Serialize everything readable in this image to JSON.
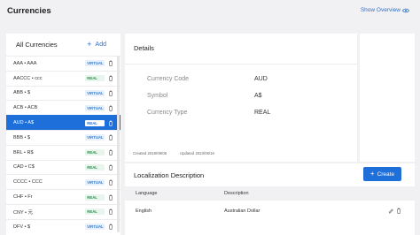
{
  "page": {
    "title": "Currencies",
    "show_overview_label": "Show Overview"
  },
  "list_panel": {
    "title": "All Currencies",
    "add_label": "Add",
    "items": [
      {
        "name": "AAA • AAA",
        "type": "VIRTUAL"
      },
      {
        "name": "AACCC • ccc",
        "type": "REAL"
      },
      {
        "name": "ABB • $",
        "type": "VIRTUAL"
      },
      {
        "name": "ACB • ACB",
        "type": "VIRTUAL"
      },
      {
        "name": "AUD • A$",
        "type": "REAL",
        "selected": true
      },
      {
        "name": "BBB • $",
        "type": "VIRTUAL"
      },
      {
        "name": "BRL • R$",
        "type": "REAL"
      },
      {
        "name": "CAD • C$",
        "type": "REAL"
      },
      {
        "name": "CCCC • CCC",
        "type": "VIRTUAL"
      },
      {
        "name": "CHF • Fr",
        "type": "REAL"
      },
      {
        "name": "CNY • 元",
        "type": "REAL"
      },
      {
        "name": "DFV • $",
        "type": "VIRTUAL"
      }
    ]
  },
  "details": {
    "title": "Details",
    "fields": [
      {
        "label": "Currency Code",
        "value": "AUD"
      },
      {
        "label": "Symbol",
        "value": "A$"
      },
      {
        "label": "Currency Type",
        "value": "REAL"
      }
    ],
    "created": "Created 2019/09/08",
    "updated": "Updated 2023/06/16"
  },
  "localization": {
    "title": "Localization Description",
    "create_label": "Create",
    "columns": [
      "Language",
      "Description"
    ],
    "rows": [
      {
        "language": "English",
        "description": "Australian Dollar"
      }
    ]
  },
  "colors": {
    "accent": "#1e6fd9",
    "link": "#2f6fc8",
    "background": "#f1f1f3"
  }
}
